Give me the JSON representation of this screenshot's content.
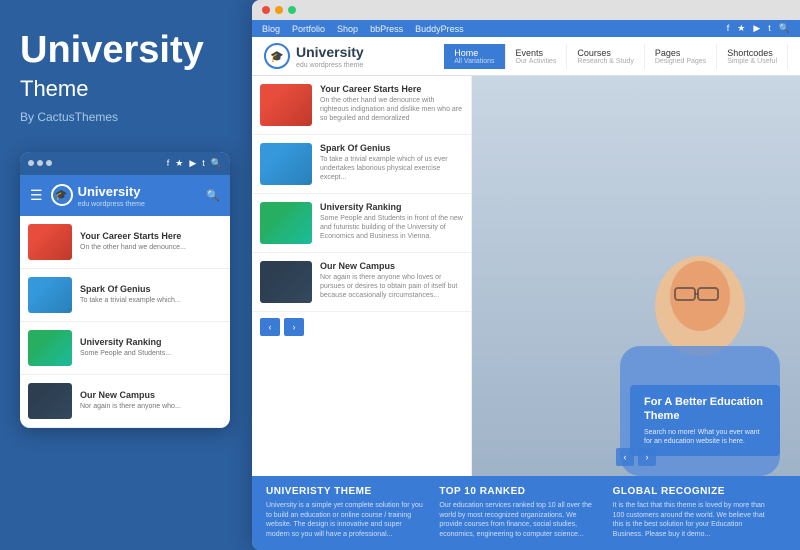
{
  "left": {
    "title": "University",
    "subtitle": "Theme",
    "by": "By CactusThemes"
  },
  "mobile": {
    "toolbar_icons": [
      "f",
      "★",
      "▶",
      "t",
      "🔍"
    ],
    "logo": "University",
    "logo_sub": "edu wordpress theme",
    "items": [
      {
        "title": "Your Career Starts Here",
        "desc": "On the other hand we denounce...",
        "thumb_class": "img-career"
      },
      {
        "title": "Spark Of Genius",
        "desc": "To take a trivial example which...",
        "thumb_class": "img-genius"
      },
      {
        "title": "University Ranking",
        "desc": "Some People and Students in front...",
        "thumb_class": "img-ranking"
      },
      {
        "title": "Our New Campus",
        "desc": "Nor again is there anyone who...",
        "thumb_class": "img-campus"
      }
    ]
  },
  "desktop": {
    "toolbar_links": [
      "Blog",
      "Portfolio",
      "Shop",
      "bbPress",
      "BuddyPress"
    ],
    "toolbar_icons": [
      "f",
      "★",
      "▶",
      "t",
      "🔍"
    ],
    "logo": "University",
    "logo_sub": "edu wordpress theme",
    "nav_items": [
      {
        "label": "Home",
        "sub": "All Variations",
        "active": true
      },
      {
        "label": "Events",
        "sub": "Our Activities"
      },
      {
        "label": "Courses",
        "sub": "Research & Study"
      },
      {
        "label": "Pages",
        "sub": "Designed Pages"
      },
      {
        "label": "Shortcodes",
        "sub": "Simple & Useful"
      }
    ],
    "list_items": [
      {
        "title": "Your Career Starts Here",
        "desc": "On the other hand we denounce with righteous indignation and dislike men who are so beguiled and demoralized",
        "thumb_class": "img-career"
      },
      {
        "title": "Spark Of Genius",
        "desc": "To take a trivial example which of us ever undertakes laborious physical exercise except...",
        "thumb_class": "img-genius"
      },
      {
        "title": "University Ranking",
        "desc": "Some People and Students in front of the new and futuristic building of the University of Economics and Business in Vienna.",
        "thumb_class": "img-ranking"
      },
      {
        "title": "Our New Campus",
        "desc": "Nor again is there anyone who loves or pursues or desires to obtain pain of itself but because occasionally circumstances...",
        "thumb_class": "img-campus"
      }
    ],
    "hero_cta_title": "For A Better Education Theme",
    "hero_cta_text": "Search no more! What you ever want for an education website is here.",
    "footer": [
      {
        "title": "UNIVERISTY THEME",
        "text": "University is a simple yet complete solution for you to build an education or online course / training website. The design is innovative and super modern so you will have a professional..."
      },
      {
        "title": "TOP 10 RANKED",
        "text": "Our education services ranked top 10 all over the world by most recognized organizations. We provide courses from finance, social studies, economics, engineering to computer science..."
      },
      {
        "title": "GLOBAL RECOGNIZE",
        "text": "It is the fact that this theme is loved by more than 100 customers around the world. We believe that this is the best solution for your Education Business. Please buy it demo..."
      }
    ]
  }
}
